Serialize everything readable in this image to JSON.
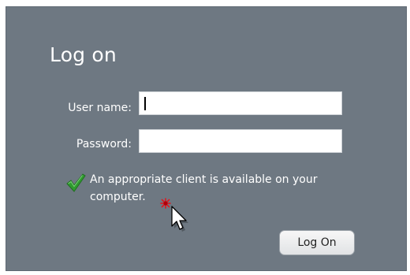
{
  "dialog": {
    "title": "Log on",
    "username_label": "User name:",
    "username_value": "",
    "password_label": "Password:",
    "password_value": "",
    "status_text": "An appropriate client is available on your computer.",
    "status_icon": "checkmark-icon",
    "logon_button_label": "Log On"
  },
  "colors": {
    "panel_background": "#6e7882",
    "check_green": "#2f9b2f"
  }
}
